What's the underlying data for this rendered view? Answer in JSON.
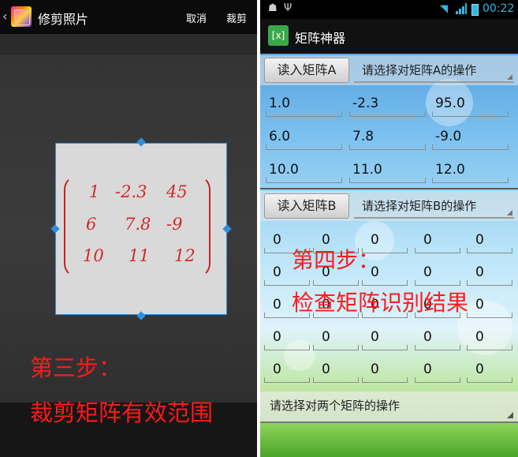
{
  "left": {
    "back_glyph": "‹",
    "title": "修剪照片",
    "cancel": "取消",
    "crop": "裁剪",
    "matrix": [
      [
        "1",
        "-2.3",
        "45"
      ],
      [
        "6",
        "7.8",
        "-9"
      ],
      [
        "10",
        "11",
        "12"
      ]
    ],
    "step_line1": "第三步：",
    "step_line2": "裁剪矩阵有效范围",
    "accent": "#ff1a1a",
    "selection_color": "#3b8fd6"
  },
  "right": {
    "status": {
      "time": "00:22",
      "icons": [
        "android-debug-icon",
        "usb-icon",
        "wifi-icon",
        "signal-icon",
        "battery-icon"
      ]
    },
    "app_icon_text": "[x]",
    "app_title": "矩阵神器",
    "matrixA": {
      "read_button": "读入矩阵A",
      "op_spinner": "请选择对矩阵A的操作",
      "rows": [
        [
          "1.0",
          "-2.3",
          "95.0"
        ],
        [
          "6.0",
          "7.8",
          "-9.0"
        ],
        [
          "10.0",
          "11.0",
          "12.0"
        ]
      ]
    },
    "matrixB": {
      "read_button": "读入矩阵B",
      "op_spinner": "请选择对矩阵B的操作",
      "rows": [
        [
          "0",
          "0",
          "0",
          "0",
          "0"
        ],
        [
          "0",
          "0",
          "0",
          "0",
          "0"
        ],
        [
          "0",
          "0",
          "0",
          "0",
          "0"
        ],
        [
          "0",
          "0",
          "0",
          "0",
          "0"
        ],
        [
          "0",
          "0",
          "0",
          "0",
          "0"
        ]
      ]
    },
    "two_matrix_spinner": "请选择对两个矩阵的操作",
    "step_line1": "第四步：",
    "step_line2": "检查矩阵识别结果"
  }
}
